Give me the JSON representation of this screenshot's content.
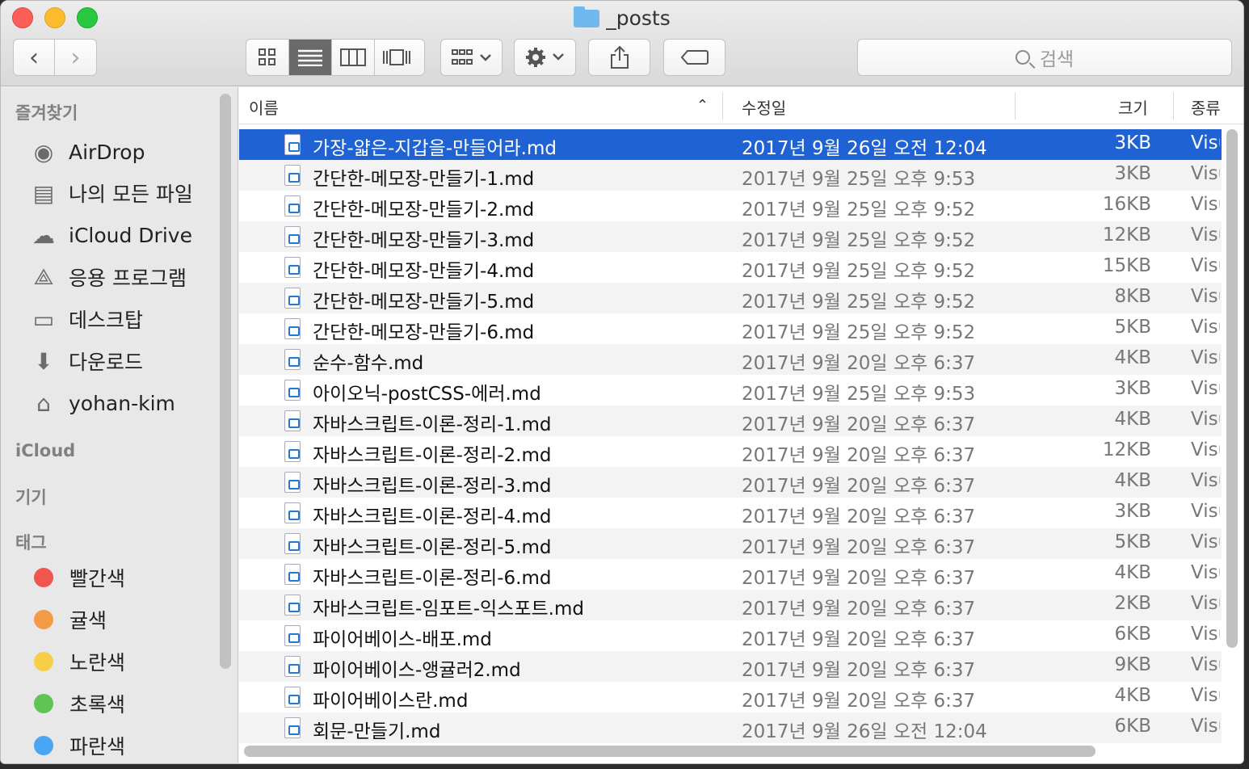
{
  "window": {
    "title": "_posts"
  },
  "toolbar": {
    "back_icon": "‹",
    "forward_icon": "›",
    "search_placeholder": "검색"
  },
  "sidebar": {
    "favorites_header": "즐겨찾기",
    "favorites": [
      {
        "label": "AirDrop",
        "icon": "airdrop-icon"
      },
      {
        "label": "나의 모든 파일",
        "icon": "all-files-icon"
      },
      {
        "label": "iCloud Drive",
        "icon": "cloud-icon"
      },
      {
        "label": "응용 프로그램",
        "icon": "applications-icon"
      },
      {
        "label": "데스크탑",
        "icon": "desktop-icon"
      },
      {
        "label": "다운로드",
        "icon": "download-icon"
      },
      {
        "label": "yohan-kim",
        "icon": "home-icon"
      }
    ],
    "icloud_header": "iCloud",
    "devices_header": "기기",
    "tags_header": "태그",
    "tags": [
      {
        "label": "빨간색",
        "color": "#f0554e"
      },
      {
        "label": "귤색",
        "color": "#f39a45"
      },
      {
        "label": "노란색",
        "color": "#f6cf47"
      },
      {
        "label": "초록색",
        "color": "#5fc453"
      },
      {
        "label": "파란색",
        "color": "#4aa5f3"
      }
    ]
  },
  "columns": {
    "name": "이름",
    "modified": "수정일",
    "size": "크기",
    "kind": "종류"
  },
  "files": [
    {
      "name": "가장-얇은-지갑을-만들어라.md",
      "date": "2017년 9월 26일 오전 12:04",
      "size": "3KB",
      "kind": "Visu",
      "selected": true
    },
    {
      "name": "간단한-메모장-만들기-1.md",
      "date": "2017년 9월 25일 오후 9:53",
      "size": "3KB",
      "kind": "Visu"
    },
    {
      "name": "간단한-메모장-만들기-2.md",
      "date": "2017년 9월 25일 오후 9:52",
      "size": "16KB",
      "kind": "Visu"
    },
    {
      "name": "간단한-메모장-만들기-3.md",
      "date": "2017년 9월 25일 오후 9:52",
      "size": "12KB",
      "kind": "Visu"
    },
    {
      "name": "간단한-메모장-만들기-4.md",
      "date": "2017년 9월 25일 오후 9:52",
      "size": "15KB",
      "kind": "Visu"
    },
    {
      "name": "간단한-메모장-만들기-5.md",
      "date": "2017년 9월 25일 오후 9:52",
      "size": "8KB",
      "kind": "Visu"
    },
    {
      "name": "간단한-메모장-만들기-6.md",
      "date": "2017년 9월 25일 오후 9:52",
      "size": "5KB",
      "kind": "Visu"
    },
    {
      "name": "순수-함수.md",
      "date": "2017년 9월 20일 오후 6:37",
      "size": "4KB",
      "kind": "Visu"
    },
    {
      "name": "아이오닉-postCSS-에러.md",
      "date": "2017년 9월 25일 오후 9:53",
      "size": "3KB",
      "kind": "Visu"
    },
    {
      "name": "자바스크립트-이론-정리-1.md",
      "date": "2017년 9월 20일 오후 6:37",
      "size": "4KB",
      "kind": "Visu"
    },
    {
      "name": "자바스크립트-이론-정리-2.md",
      "date": "2017년 9월 20일 오후 6:37",
      "size": "12KB",
      "kind": "Visu"
    },
    {
      "name": "자바스크립트-이론-정리-3.md",
      "date": "2017년 9월 20일 오후 6:37",
      "size": "4KB",
      "kind": "Visu"
    },
    {
      "name": "자바스크립트-이론-정리-4.md",
      "date": "2017년 9월 20일 오후 6:37",
      "size": "3KB",
      "kind": "Visu"
    },
    {
      "name": "자바스크립트-이론-정리-5.md",
      "date": "2017년 9월 20일 오후 6:37",
      "size": "5KB",
      "kind": "Visu"
    },
    {
      "name": "자바스크립트-이론-정리-6.md",
      "date": "2017년 9월 20일 오후 6:37",
      "size": "4KB",
      "kind": "Visu"
    },
    {
      "name": "자바스크립트-임포트-익스포트.md",
      "date": "2017년 9월 20일 오후 6:37",
      "size": "2KB",
      "kind": "Visu"
    },
    {
      "name": "파이어베이스-배포.md",
      "date": "2017년 9월 20일 오후 6:37",
      "size": "6KB",
      "kind": "Visu"
    },
    {
      "name": "파이어베이스-앵귤러2.md",
      "date": "2017년 9월 20일 오후 6:37",
      "size": "9KB",
      "kind": "Visu"
    },
    {
      "name": "파이어베이스란.md",
      "date": "2017년 9월 20일 오후 6:37",
      "size": "4KB",
      "kind": "Visu"
    },
    {
      "name": "회문-만들기.md",
      "date": "2017년 9월 26일 오전 12:04",
      "size": "6KB",
      "kind": "Visu"
    }
  ]
}
